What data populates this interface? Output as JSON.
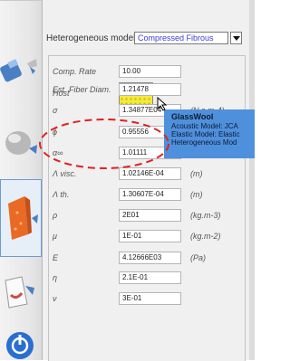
{
  "material_combo": {
    "label": "Heterogeneous model:",
    "selected": "Compressed Fibrous"
  },
  "properties": {
    "host": {
      "label": "Host"
    },
    "rows": [
      {
        "label": "Comp. Rate",
        "value": "10.00",
        "unit": ""
      },
      {
        "label": "Est. Fiber Diam.",
        "value": "1.21478",
        "unit": ""
      },
      {
        "label": "σ",
        "value": "1.34877E04",
        "unit": "(N.s.m-4)"
      },
      {
        "label": "ϕ",
        "value": "0.95556",
        "unit": ""
      },
      {
        "label": "α∞",
        "value": "1.01111",
        "unit": ""
      },
      {
        "label": "Λ visc.",
        "value": "1.02146E-04",
        "unit": "(m)"
      },
      {
        "label": "Λ th.",
        "value": "1.30607E-04",
        "unit": "(m)"
      },
      {
        "label": "ρ",
        "value": "2E01",
        "unit": "(kg.m-3)"
      },
      {
        "label": "μ",
        "value": "1E-01",
        "unit": "(kg.m-2)"
      },
      {
        "label": "E",
        "value": "4.12666E03",
        "unit": "(Pa)"
      },
      {
        "label": "η",
        "value": "2.1E-01",
        "unit": ""
      },
      {
        "label": "ν",
        "value": "3E-01",
        "unit": ""
      }
    ]
  },
  "tooltip": {
    "title": "GlassWool",
    "lines": [
      "Acoustic Model: JCA",
      "Elastic Model: Elastic",
      "Heterogeneous Mod"
    ]
  },
  "toolbar_icons": [
    "layer-tool-icon",
    "sphere-tool-icon",
    "material-layer-icon",
    "document-arrow-icon",
    "power-icon"
  ],
  "colors": {
    "tooltip_bg": "#4f90dc",
    "annotation_red": "#e02020",
    "host_swatch": "#f4e93d",
    "combo_text": "#3b3bd9"
  }
}
